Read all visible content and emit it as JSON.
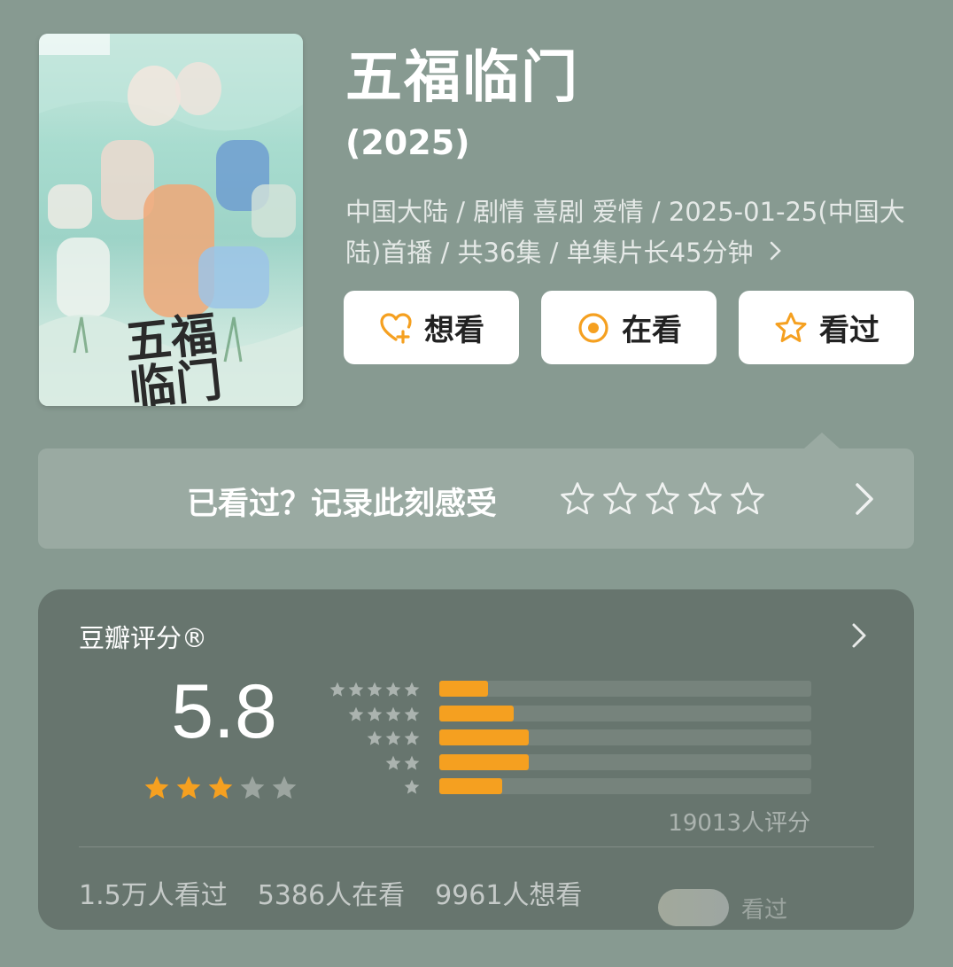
{
  "poster": {
    "title_chars": "五福临门",
    "colors": {
      "sky": "#a8dccf",
      "mist": "#e6f1ec",
      "ink": "#2a2a2a"
    }
  },
  "header": {
    "title": "五福临门",
    "year": "(2025)",
    "meta_line": "中国大陆 / 剧情 喜剧 爱情 / 2025-01-25(中国大陆)首播 / 共36集 / 单集片长45分钟",
    "meta_more_icon": "chevron-right-icon"
  },
  "actions": {
    "want_label": "想看",
    "want_icon": "heart-plus-icon",
    "doing_label": "在看",
    "doing_icon": "target-circle-icon",
    "done_label": "看过",
    "done_icon": "star-outline-icon",
    "accent": "#f5a020"
  },
  "rate_prompt": {
    "text": "已看过？记录此刻感受",
    "stars": 5,
    "icon": "chevron-right-icon"
  },
  "rating": {
    "label": "豆瓣评分®",
    "score": "5.8",
    "filled_stars": 3,
    "total_stars": 5,
    "star_color": "#f5a020",
    "distribution": [
      {
        "stars": 5,
        "fraction": 0.13
      },
      {
        "stars": 4,
        "fraction": 0.2
      },
      {
        "stars": 3,
        "fraction": 0.24
      },
      {
        "stars": 2,
        "fraction": 0.24
      },
      {
        "stars": 1,
        "fraction": 0.17
      }
    ],
    "count": "19013人评分",
    "stats": [
      "1.5万人看过",
      "5386人在看",
      "9961人想看"
    ],
    "watermark_text": "看过"
  }
}
